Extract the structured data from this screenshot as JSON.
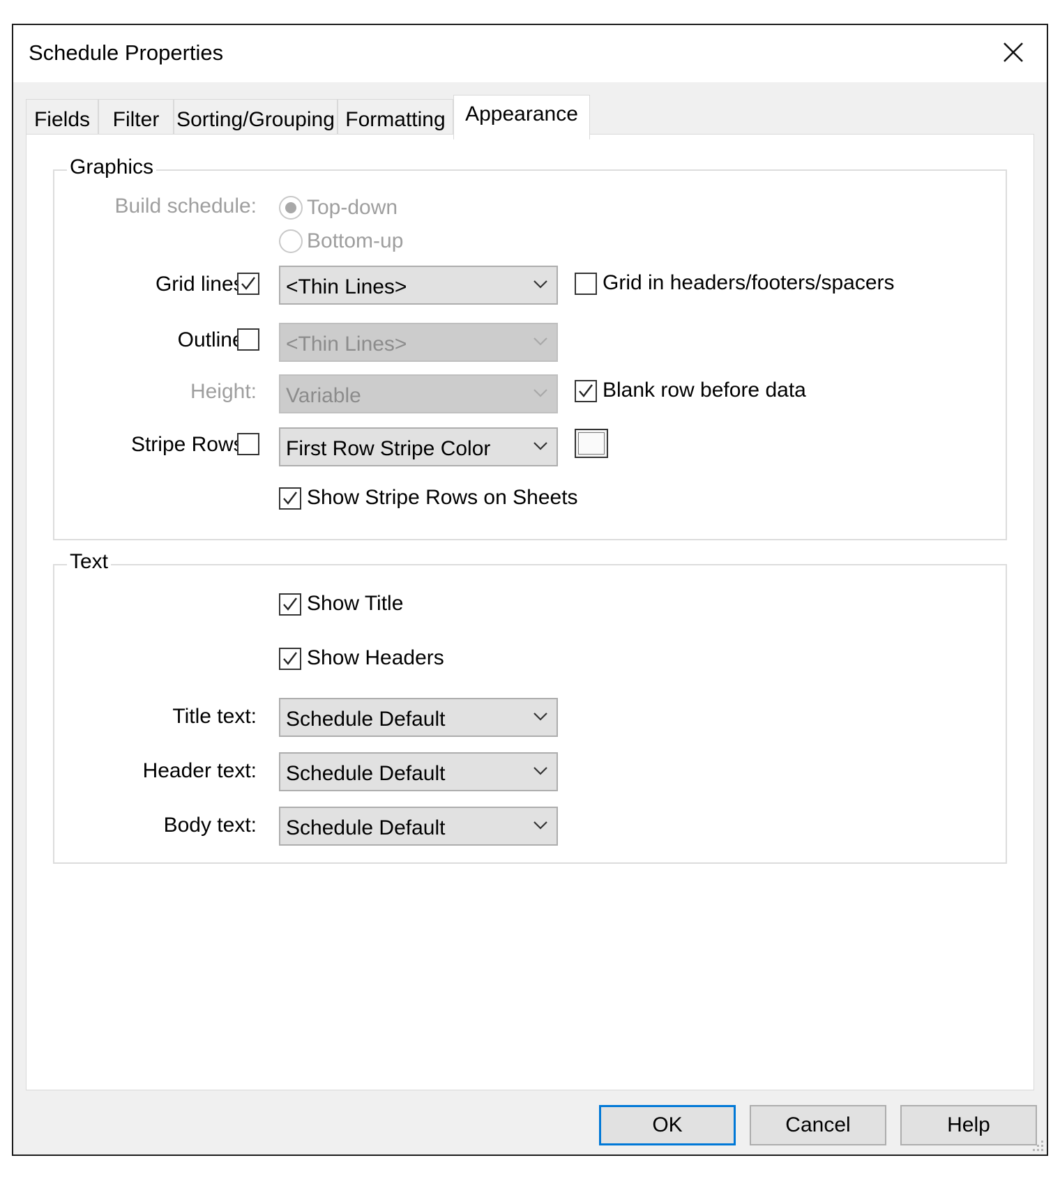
{
  "dialog": {
    "title": "Schedule Properties"
  },
  "tabs": [
    {
      "label": "Fields",
      "active": false
    },
    {
      "label": "Filter",
      "active": false
    },
    {
      "label": "Sorting/Grouping",
      "active": false
    },
    {
      "label": "Formatting",
      "active": false
    },
    {
      "label": "Appearance",
      "active": true
    }
  ],
  "graphics": {
    "legend": "Graphics",
    "build_schedule": {
      "label": "Build schedule:",
      "options": [
        "Top-down",
        "Bottom-up"
      ],
      "selected": "Top-down",
      "enabled": false
    },
    "grid_lines": {
      "label": "Grid lines:",
      "checked": true,
      "value": "<Thin Lines>",
      "headers_label": "Grid in headers/footers/spacers",
      "headers_checked": false
    },
    "outline": {
      "label": "Outline:",
      "checked": false,
      "value": "<Thin Lines>",
      "enabled": false
    },
    "height": {
      "label": "Height:",
      "value": "Variable",
      "enabled": false,
      "blank_row_label": "Blank row before data",
      "blank_row_checked": true
    },
    "stripe_rows": {
      "label": "Stripe Rows:",
      "checked": false,
      "value": "First Row Stripe Color",
      "show_on_sheets_label": "Show Stripe Rows on Sheets",
      "show_on_sheets_checked": true
    }
  },
  "text": {
    "legend": "Text",
    "show_title": {
      "label": "Show Title",
      "checked": true
    },
    "show_headers": {
      "label": "Show Headers",
      "checked": true
    },
    "title_text": {
      "label": "Title text:",
      "value": "Schedule Default"
    },
    "header_text": {
      "label": "Header text:",
      "value": "Schedule Default"
    },
    "body_text": {
      "label": "Body text:",
      "value": "Schedule Default"
    }
  },
  "buttons": {
    "ok": "OK",
    "cancel": "Cancel",
    "help": "Help"
  },
  "colors": {
    "default_button_border": "#0078d7",
    "dialog_bg": "#f0f0f0",
    "disabled_text": "#9e9e9e"
  }
}
